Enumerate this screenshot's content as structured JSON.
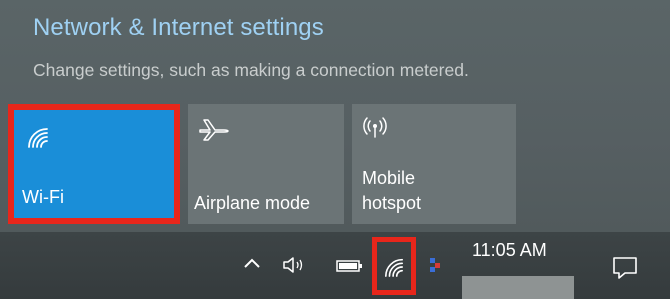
{
  "panel": {
    "title": "Network & Internet settings",
    "subtitle": "Change settings, such as making a connection metered.",
    "accent_color": "#1a8ed8",
    "highlight_color": "#e8261b"
  },
  "tiles": [
    {
      "label": "Wi-Fi",
      "icon": "wifi-icon",
      "active": true
    },
    {
      "label": "Airplane mode",
      "icon": "airplane-icon",
      "active": false
    },
    {
      "label": "Mobile\nhotspot",
      "icon": "mobile-hotspot-icon",
      "active": false
    }
  ],
  "taskbar": {
    "icons": [
      "chevron-up-icon",
      "volume-icon",
      "battery-icon",
      "wifi-icon",
      "app-icon",
      "notification-icon"
    ],
    "time": "11:05 AM"
  }
}
